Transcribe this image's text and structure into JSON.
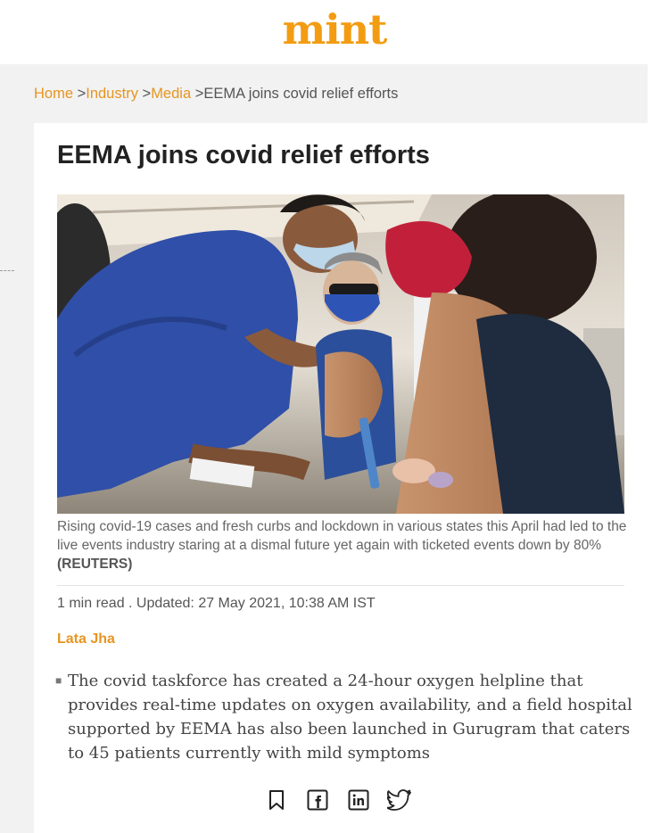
{
  "site": {
    "logo_text": "mint",
    "brand_color": "#f39c12"
  },
  "breadcrumb": {
    "items": [
      {
        "label": "Home"
      },
      {
        "label": "Industry"
      },
      {
        "label": "Media"
      }
    ],
    "current": "EEMA joins covid relief efforts",
    "separator": ">"
  },
  "article": {
    "title": "EEMA joins covid relief efforts",
    "image": {
      "icon": "photo-vaccination"
    },
    "caption": "Rising covid-19 cases and fresh curbs and lockdown in various states this April had led to the live events industry staring at a dismal future yet again with ticketed events down by 80%",
    "caption_credit": "(REUTERS)",
    "meta": "1 min read . Updated: 27 May 2021, 10:38 AM IST",
    "author": "Lata Jha",
    "summary": "The covid taskforce has created a 24-hour oxygen helpline that provides real-time updates on oxygen availability, and a field hospital supported by EEMA has also been launched in Gurugram that caters to 45 patients currently with mild symptoms"
  },
  "share": {
    "icons": [
      "bookmark-icon",
      "facebook-icon",
      "linkedin-icon",
      "twitter-icon"
    ]
  }
}
